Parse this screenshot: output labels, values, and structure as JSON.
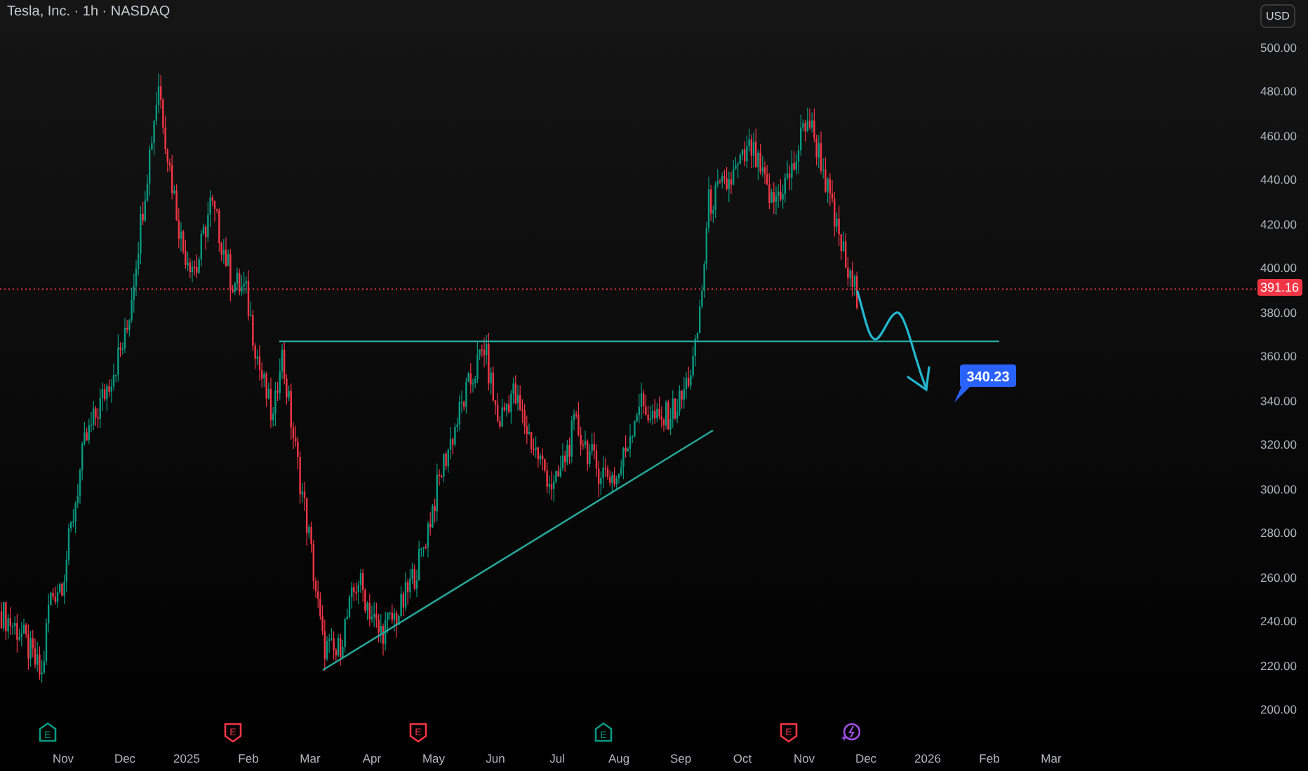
{
  "header": {
    "title": "Tesla, Inc. · 1h · NASDAQ"
  },
  "currency_button": "USD",
  "price_axis": {
    "ticks": [
      "500.00",
      "480.00",
      "460.00",
      "440.00",
      "420.00",
      "400.00",
      "380.00",
      "360.00",
      "340.00",
      "320.00",
      "300.00",
      "280.00",
      "260.00",
      "240.00",
      "220.00",
      "200.00"
    ],
    "last_price": "391.16"
  },
  "annotation": {
    "target_label": "340.23"
  },
  "time_axis": {
    "labels": [
      {
        "label": "Nov",
        "event": {
          "kind": "earnings_beat",
          "glyph": "E",
          "color": "#089981"
        }
      },
      {
        "label": "Dec"
      },
      {
        "label": "2025"
      },
      {
        "label": "Feb",
        "event": {
          "kind": "earnings_miss",
          "glyph": "E",
          "color": "#f23645"
        }
      },
      {
        "label": "Mar"
      },
      {
        "label": "Apr"
      },
      {
        "label": "May",
        "event": {
          "kind": "earnings_miss",
          "glyph": "E",
          "color": "#f23645"
        }
      },
      {
        "label": "Jun"
      },
      {
        "label": "Jul"
      },
      {
        "label": "Aug",
        "event": {
          "kind": "earnings_beat",
          "glyph": "E",
          "color": "#089981"
        }
      },
      {
        "label": "Sep"
      },
      {
        "label": "Oct"
      },
      {
        "label": "Nov",
        "event": {
          "kind": "earnings_miss",
          "glyph": "E",
          "color": "#f23645"
        }
      },
      {
        "label": "Dec",
        "event": {
          "kind": "dividend",
          "color": "#9c4fe0"
        }
      },
      {
        "label": "2026"
      },
      {
        "label": "Feb"
      },
      {
        "label": "Mar"
      }
    ]
  }
}
